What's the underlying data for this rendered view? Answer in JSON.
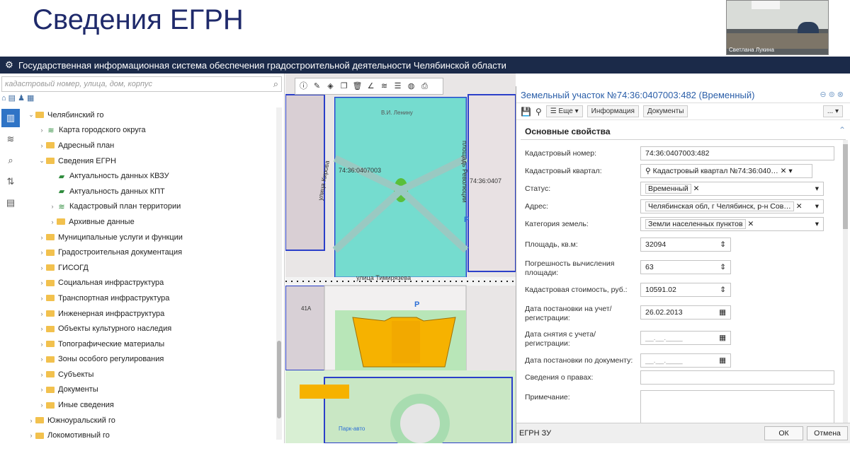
{
  "slide": {
    "title": "Сведения ЕГРН"
  },
  "webcam": {
    "name": "Светлана Лукина"
  },
  "app": {
    "title": "Государственная информационная система обеспечения градостроительной деятельности Челябинской области"
  },
  "search": {
    "placeholder": "кадастровый номер, улица, дом, корпус"
  },
  "tree": [
    {
      "label": "Челябинский го",
      "type": "folder",
      "indent": 0,
      "arrow": "v"
    },
    {
      "label": "Карта городского округа",
      "type": "layer",
      "indent": 1,
      "arrow": ">"
    },
    {
      "label": "Адресный план",
      "type": "folder",
      "indent": 1,
      "arrow": ">"
    },
    {
      "label": "Сведения ЕГРН",
      "type": "folder",
      "indent": 1,
      "arrow": "v"
    },
    {
      "label": "Актуальность данных КВЗУ",
      "type": "leaf",
      "indent": 2,
      "arrow": ""
    },
    {
      "label": "Актуальность данных КПТ",
      "type": "leaf",
      "indent": 2,
      "arrow": ""
    },
    {
      "label": "Кадастровый план территории",
      "type": "layer",
      "indent": 2,
      "arrow": ">"
    },
    {
      "label": "Архивные данные",
      "type": "folder",
      "indent": 2,
      "arrow": ">"
    },
    {
      "label": "Муниципальные услуги и функции",
      "type": "folder",
      "indent": 1,
      "arrow": ">"
    },
    {
      "label": "Градостроительная документация",
      "type": "folder",
      "indent": 1,
      "arrow": ">"
    },
    {
      "label": "ГИСОГД",
      "type": "folder",
      "indent": 1,
      "arrow": ">"
    },
    {
      "label": "Социальная инфраструктура",
      "type": "folder",
      "indent": 1,
      "arrow": ">"
    },
    {
      "label": "Транспортная инфраструктура",
      "type": "folder",
      "indent": 1,
      "arrow": ">"
    },
    {
      "label": "Инженерная инфраструктура",
      "type": "folder",
      "indent": 1,
      "arrow": ">"
    },
    {
      "label": "Объекты культурного наследия",
      "type": "folder",
      "indent": 1,
      "arrow": ">"
    },
    {
      "label": "Топографические материалы",
      "type": "folder",
      "indent": 1,
      "arrow": ">"
    },
    {
      "label": "Зоны особого регулирования",
      "type": "folder",
      "indent": 1,
      "arrow": ">"
    },
    {
      "label": "Субъекты",
      "type": "folder",
      "indent": 1,
      "arrow": ">"
    },
    {
      "label": "Документы",
      "type": "folder",
      "indent": 1,
      "arrow": ">"
    },
    {
      "label": "Иные сведения",
      "type": "folder",
      "indent": 1,
      "arrow": ">"
    },
    {
      "label": "Южноуральский го",
      "type": "folder",
      "indent": 0,
      "arrow": ">"
    },
    {
      "label": "Локомотивный го",
      "type": "folder",
      "indent": 0,
      "arrow": ">"
    }
  ],
  "map": {
    "labels": [
      "74:36:0407003",
      "74:36:0407",
      "улица Тимирязева",
      "площадь Революции",
      "улица Кирова",
      "В.И. Ленину",
      "P",
      "P",
      "41А",
      "Парк-авто"
    ]
  },
  "dialog": {
    "title": "Земельный участок №74:36:0407003:482 (Временный)",
    "more_label": "Еще",
    "tab_info": "Информация",
    "tab_docs": "Документы",
    "more_menu": "...",
    "section": "Основные свойства",
    "fields": {
      "cadastral_number_label": "Кадастровый номер:",
      "cadastral_number": "74:36:0407003:482",
      "quarter_label": "Кадастровый квартал:",
      "quarter": "Кадастровый квартал №74:36:040…",
      "status_label": "Статус:",
      "status": "Временный",
      "address_label": "Адрес:",
      "address": "Челябинская обл, г Челябинск, р-н Сов…",
      "category_label": "Категория земель:",
      "category": "Земли населенных пунктов",
      "area_label": "Площадь, кв.м:",
      "area": "32094",
      "error_label_1": "Погрешность вычисления",
      "error_label_2": "площади:",
      "error": "63",
      "cost_label": "Кадастровая стоимость, руб.:",
      "cost": "10591.02",
      "reg_date_label_1": "Дата постановки на учет/",
      "reg_date_label_2": "регистрации:",
      "reg_date": "26.02.2013",
      "unreg_date_label_1": "Дата снятия с учета/",
      "unreg_date_label_2": "регистрации:",
      "unreg_date": "__.__.____",
      "doc_date_label": "Дата постановки по документу:",
      "doc_date": "__.__.____",
      "rights_label": "Сведения о правах:",
      "note_label": "Примечание:"
    },
    "footer_label": "ЕГРН ЗУ",
    "ok": "ОК",
    "cancel": "Отмена"
  }
}
